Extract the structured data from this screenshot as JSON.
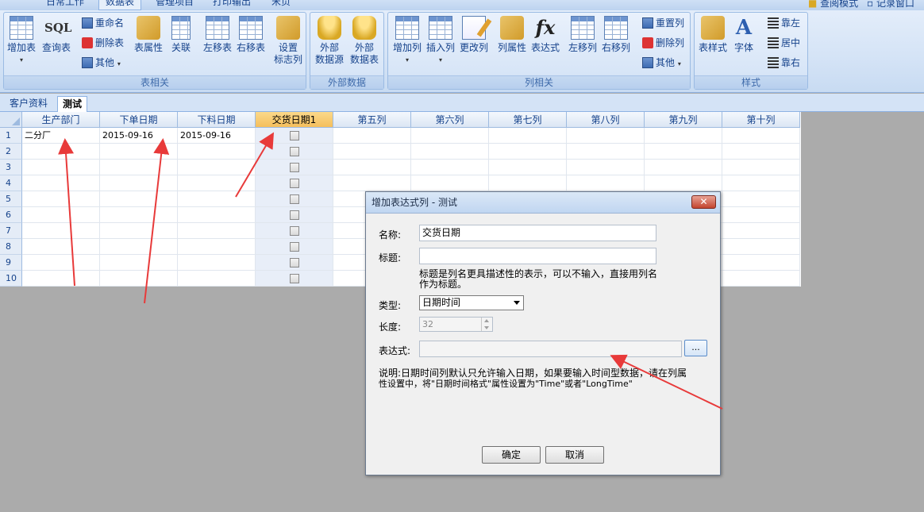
{
  "menu": {
    "tabs": [
      "日常工作",
      "数据表",
      "管理项目",
      "打印输出",
      "宋页"
    ],
    "right": [
      "查阅模式",
      "记录窗口"
    ]
  },
  "ribbon": {
    "groups": {
      "table": "表相关",
      "external": "外部数据",
      "column": "列相关",
      "style": "样式"
    },
    "table_big": [
      "增加表",
      "查询表",
      "表属性",
      "关联",
      "左移表",
      "右移表",
      "设置\n标志列"
    ],
    "sql_icon": "SQL",
    "table_small": [
      "重命名",
      "删除表",
      "其他"
    ],
    "external_big": [
      "外部\n数据源",
      "外部\n数据表"
    ],
    "column_big": [
      "增加列",
      "插入列",
      "更改列",
      "列属性",
      "表达式",
      "左移列",
      "右移列"
    ],
    "fx_icon": "fx",
    "column_small": [
      "重置列",
      "删除列",
      "其他"
    ],
    "style_big": [
      "表样式",
      "字体"
    ],
    "font_icon": "A",
    "style_small": [
      "靠左",
      "居中",
      "靠右"
    ]
  },
  "sheet_tabs": [
    "客户资料",
    "测试"
  ],
  "grid": {
    "columns": [
      "生产部门",
      "下单日期",
      "下料日期",
      "交货日期1",
      "第五列",
      "第六列",
      "第七列",
      "第八列",
      "第九列",
      "第十列"
    ],
    "rows": [
      [
        "二分厂",
        "2015-09-16",
        "2015-09-16",
        "",
        "",
        "",
        "",
        "",
        "",
        ""
      ],
      [
        "",
        "",
        "",
        "",
        "",
        "",
        "",
        "",
        "",
        ""
      ],
      [
        "",
        "",
        "",
        "",
        "",
        "",
        "",
        "",
        "",
        ""
      ],
      [
        "",
        "",
        "",
        "",
        "",
        "",
        "",
        "",
        "",
        ""
      ],
      [
        "",
        "",
        "",
        "",
        "",
        "",
        "",
        "",
        "",
        ""
      ],
      [
        "",
        "",
        "",
        "",
        "",
        "",
        "",
        "",
        "",
        ""
      ],
      [
        "",
        "",
        "",
        "",
        "",
        "",
        "",
        "",
        "",
        ""
      ],
      [
        "",
        "",
        "",
        "",
        "",
        "",
        "",
        "",
        "",
        ""
      ],
      [
        "",
        "",
        "",
        "",
        "",
        "",
        "",
        "",
        "",
        ""
      ],
      [
        "",
        "",
        "",
        "",
        "",
        "",
        "",
        "",
        "",
        ""
      ]
    ],
    "row_numbers": [
      "1",
      "2",
      "3",
      "4",
      "5",
      "6",
      "7",
      "8",
      "9",
      "10"
    ]
  },
  "dialog": {
    "title": "增加表达式列 - 测试",
    "close": "✕",
    "name_label": "名称:",
    "name_value": "交货日期",
    "caption_label": "标题:",
    "caption_value": "",
    "caption_hint_1": "标题是列名更具描述性的表示，可以不输入，直接用列名",
    "caption_hint_2": "作为标题。",
    "type_label": "类型:",
    "type_value": "日期时间",
    "length_label": "长度:",
    "length_value": "32",
    "expr_label": "表达式:",
    "expr_value": "",
    "ellipsis": "...",
    "note_1": "说明:日期时间列默认只允许输入日期，如果要输入时间型数据，请在列属",
    "note_2": "性设置中，将\"日期时间格式\"属性设置为\"Time\"或者\"LongTime\"",
    "ok": "确定",
    "cancel": "取消"
  },
  "colors": {
    "annotation_arrow": "#e83a3a",
    "selected_column": "#f5bf5c"
  }
}
